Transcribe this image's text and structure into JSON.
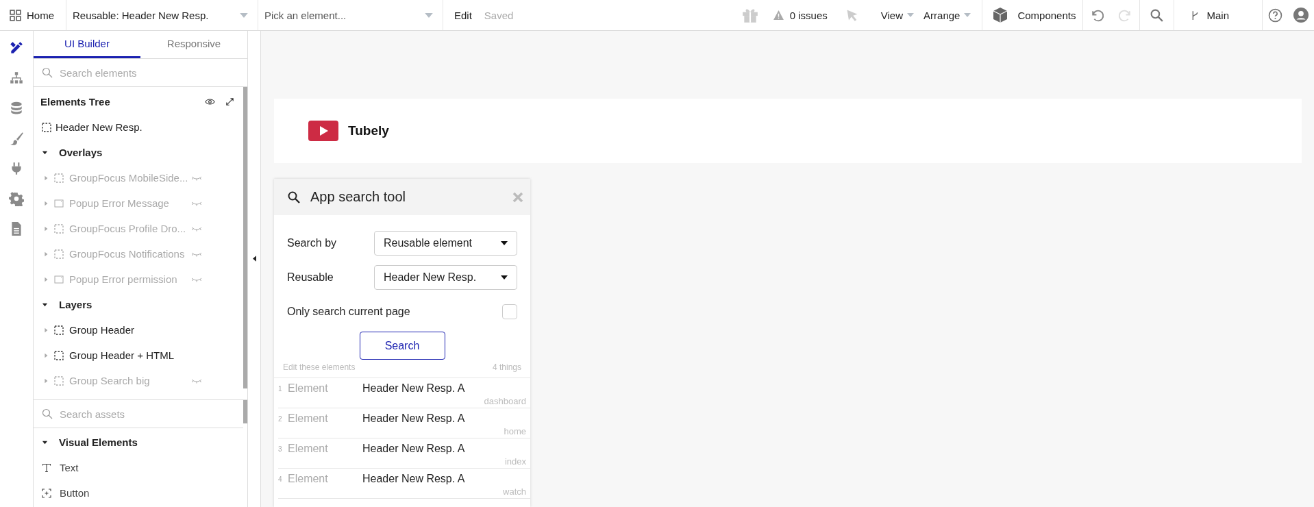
{
  "topbar": {
    "home": "Home",
    "page_dropdown": "Reusable: Header New Resp.",
    "element_dropdown": {
      "placeholder": "Pick an element..."
    },
    "edit": "Edit",
    "saved": "Saved",
    "issues": "0 issues",
    "menus": [
      "View",
      "Arrange"
    ],
    "components": "Components",
    "undo": {
      "disabled": false
    },
    "redo": {
      "disabled": true
    },
    "branch": "Main"
  },
  "rail": [
    {
      "kind": "design",
      "selected": true
    },
    {
      "kind": "workflow",
      "selected": false
    },
    {
      "kind": "data",
      "selected": false
    },
    {
      "kind": "styles",
      "selected": false
    },
    {
      "kind": "plugins",
      "selected": false
    },
    {
      "kind": "settings",
      "selected": false
    },
    {
      "kind": "logs",
      "selected": false
    }
  ],
  "sidebar": {
    "tabs": [
      {
        "label": "UI Builder",
        "selected": true
      },
      {
        "label": "Responsive",
        "selected": false
      }
    ],
    "search": {
      "placeholder": "Search elements"
    },
    "tree": {
      "title": "Elements Tree",
      "root": "Header New Resp.",
      "sections": [
        {
          "label": "Overlays",
          "expanded": true,
          "children": [
            {
              "label": "GroupFocus MobileSide...",
              "kind": "group",
              "hidden": true,
              "expanded": false
            },
            {
              "label": "Popup Error Message",
              "kind": "popup",
              "hidden": true,
              "expanded": false
            },
            {
              "label": "GroupFocus Profile Dro...",
              "kind": "group",
              "hidden": true,
              "expanded": false
            },
            {
              "label": "GroupFocus Notifications",
              "kind": "group",
              "hidden": true,
              "expanded": false
            },
            {
              "label": "Popup Error permission",
              "kind": "popup",
              "hidden": true,
              "expanded": false
            }
          ]
        },
        {
          "label": "Layers",
          "expanded": true,
          "children": [
            {
              "label": "Group Header",
              "kind": "group",
              "hidden": false,
              "expanded": false
            },
            {
              "label": "Group Header + HTML",
              "kind": "group",
              "hidden": false,
              "expanded": false
            },
            {
              "label": "Group Search big",
              "kind": "group",
              "hidden": true,
              "expanded": false
            }
          ]
        }
      ]
    },
    "assets": {
      "search": {
        "placeholder": "Search assets"
      },
      "section": {
        "label": "Visual Elements",
        "expanded": true
      },
      "items": [
        {
          "label": "Text",
          "kind": "text"
        },
        {
          "label": "Button",
          "kind": "button"
        }
      ]
    }
  },
  "canvas": {
    "header": {
      "logo_text": "Tubely"
    },
    "search_tool": {
      "title": "App search tool",
      "fields": [
        {
          "label": "Search by",
          "value": "Reusable element"
        },
        {
          "label": "Reusable",
          "value": "Header New Resp."
        }
      ],
      "checkbox": {
        "label": "Only search current page",
        "checked": false
      },
      "button": "Search",
      "results_label": "Edit these elements",
      "count": "4 things",
      "results": [
        {
          "index": "1",
          "type": "Element",
          "name": "Header New Resp. A",
          "page": "dashboard"
        },
        {
          "index": "2",
          "type": "Element",
          "name": "Header New Resp. A",
          "page": "home"
        },
        {
          "index": "3",
          "type": "Element",
          "name": "Header New Resp. A",
          "page": "index"
        },
        {
          "index": "4",
          "type": "Element",
          "name": "Header New Resp. A",
          "page": "watch"
        }
      ]
    }
  }
}
